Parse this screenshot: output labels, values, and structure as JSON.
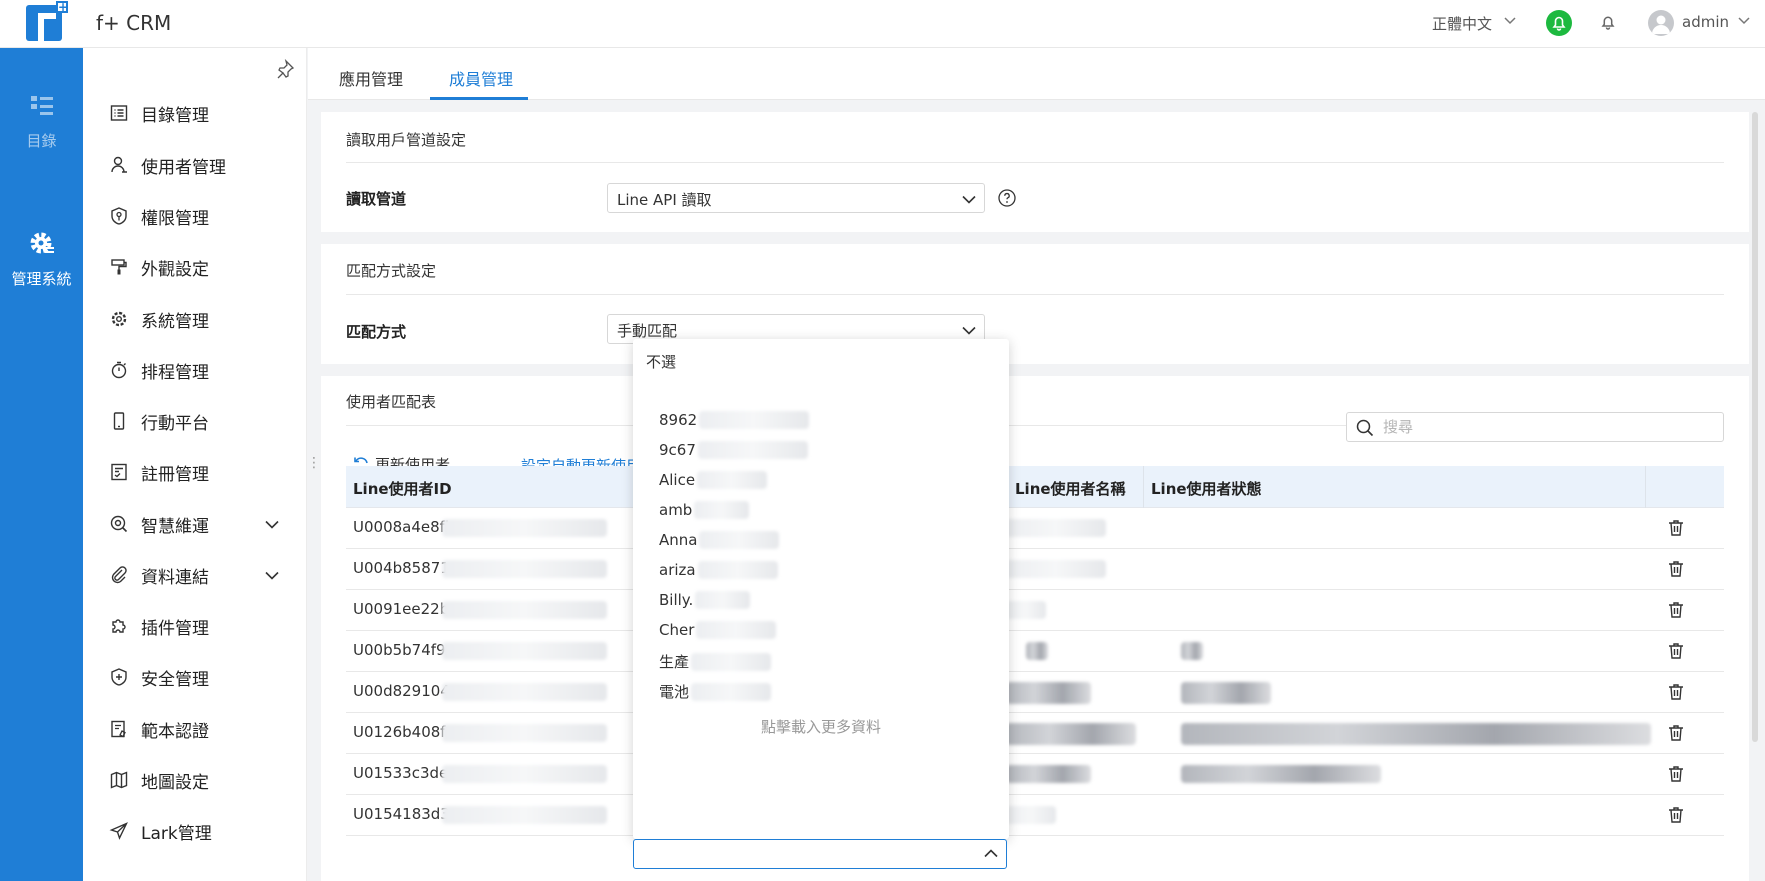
{
  "header": {
    "app_title": "f+ CRM",
    "language": "正體中文",
    "user": "admin"
  },
  "rail": {
    "items": [
      {
        "label": "目錄",
        "icon": "catalog-icon"
      },
      {
        "label": "管理系統",
        "icon": "gear-icon"
      }
    ]
  },
  "sidebar": {
    "items": [
      {
        "label": "目錄管理",
        "icon": "list-icon"
      },
      {
        "label": "使用者管理",
        "icon": "user-icon"
      },
      {
        "label": "權限管理",
        "icon": "shield-key-icon"
      },
      {
        "label": "外觀設定",
        "icon": "paint-roller-icon"
      },
      {
        "label": "系統管理",
        "icon": "gear-icon"
      },
      {
        "label": "排程管理",
        "icon": "timer-icon"
      },
      {
        "label": "行動平台",
        "icon": "mobile-icon"
      },
      {
        "label": "註冊管理",
        "icon": "register-icon"
      },
      {
        "label": "智慧維運",
        "icon": "smart-ops-icon",
        "expandable": true
      },
      {
        "label": "資料連結",
        "icon": "paperclip-icon",
        "expandable": true
      },
      {
        "label": "插件管理",
        "icon": "puzzle-icon"
      },
      {
        "label": "安全管理",
        "icon": "shield-plus-icon"
      },
      {
        "label": "範本認證",
        "icon": "template-icon"
      },
      {
        "label": "地圖設定",
        "icon": "map-icon"
      },
      {
        "label": "Lark管理",
        "icon": "send-icon"
      }
    ]
  },
  "tabs": [
    {
      "label": "應用管理",
      "active": false
    },
    {
      "label": "成員管理",
      "active": true
    }
  ],
  "read_channel": {
    "section_title": "讀取用戶管道設定",
    "label": "讀取管道",
    "value": "Line API 讀取"
  },
  "match_mode": {
    "section_title": "匹配方式設定",
    "label": "匹配方式",
    "value": "手動匹配"
  },
  "user_match": {
    "section_title": "使用者匹配表",
    "refresh_label": "更新使用者",
    "auto_update_label": "設定自動更新使用",
    "search_placeholder": "搜尋",
    "columns": [
      "Line使用者ID",
      "Line使用者名稱",
      "Line使用者狀態"
    ],
    "rows": [
      {
        "id": "U0008a4e8fb"
      },
      {
        "id": "U004b85871"
      },
      {
        "id": "U0091ee22b"
      },
      {
        "id": "U00b5b74f9"
      },
      {
        "id": "U00d829104"
      },
      {
        "id": "U0126b408f"
      },
      {
        "id": "U01533c3de"
      },
      {
        "id": "U0154183d3"
      }
    ]
  },
  "dropdown": {
    "none_option": "不選",
    "options": [
      "8962",
      "9c67",
      "Alice",
      "amb",
      "Anna",
      "ariza",
      "Billy.",
      "Cher",
      "生產",
      "電池"
    ],
    "load_more": "點擊載入更多資料"
  },
  "colors": {
    "primary": "#1f7ed6",
    "rail": "#1f7ed6",
    "bell_badge": "#1db93f"
  }
}
